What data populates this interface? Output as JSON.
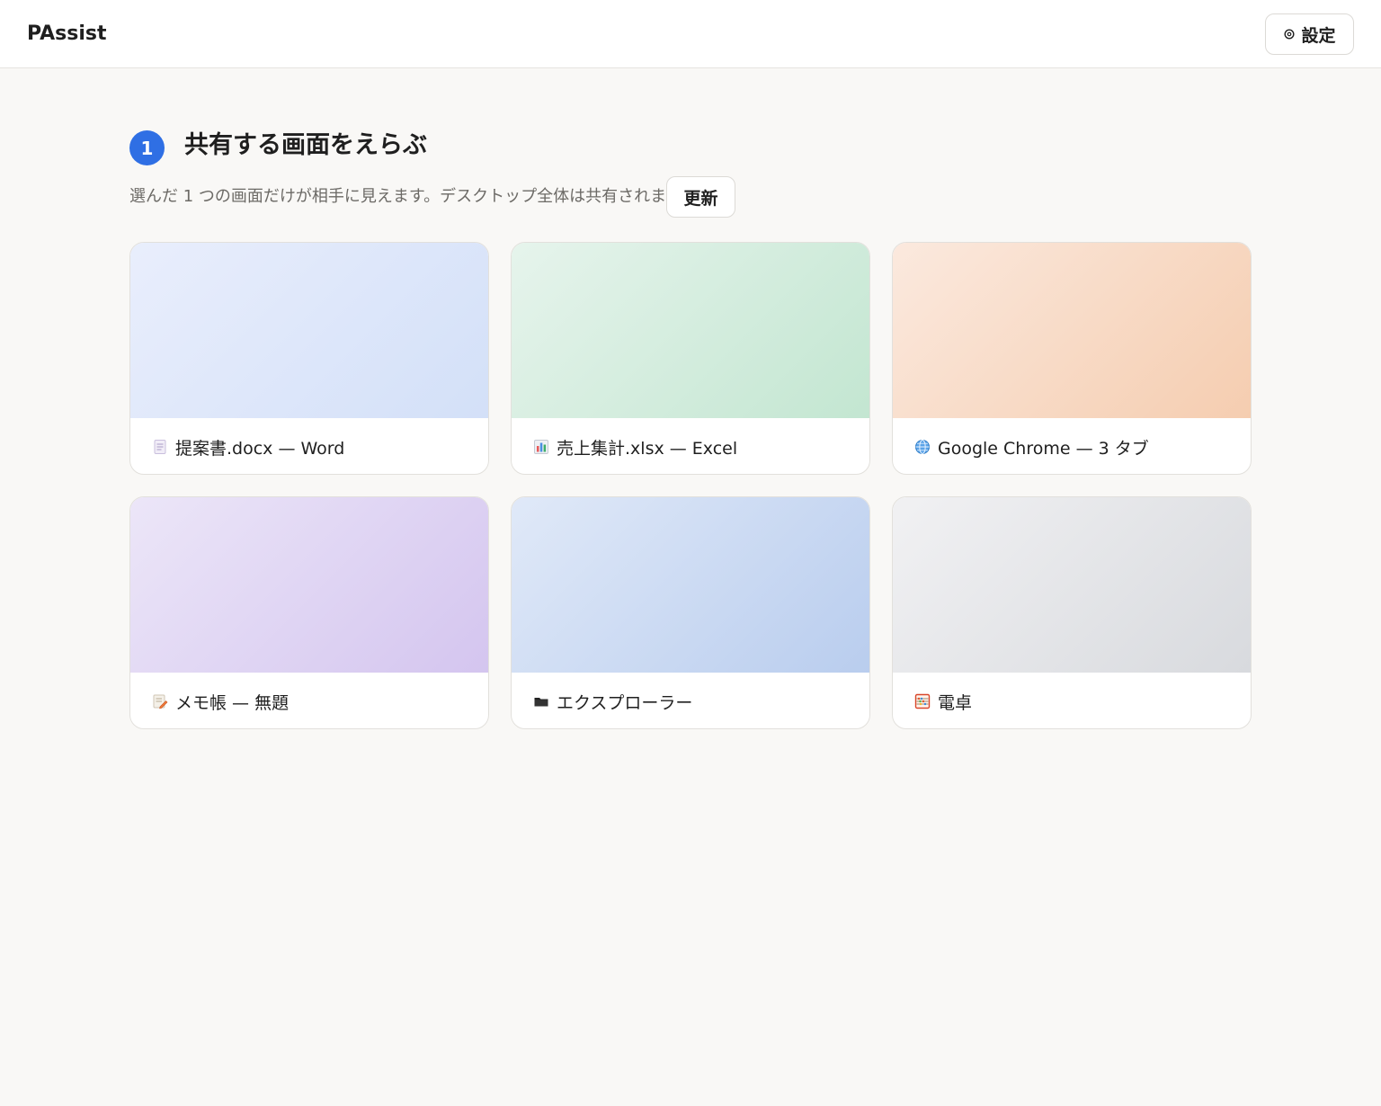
{
  "header": {
    "app_title": "PAssist",
    "settings_label": "設定"
  },
  "step": {
    "number": "1",
    "title": "共有する画面をえらぶ",
    "subtitle": "選んだ 1 つの画面だけが相手に見えます。デスクトップ全体は共有されません。",
    "refresh_label": "更新"
  },
  "windows": [
    {
      "label": "提案書.docx — Word",
      "icon": "document-icon"
    },
    {
      "label": "売上集計.xlsx — Excel",
      "icon": "bar-chart-icon"
    },
    {
      "label": "Google Chrome — 3 タブ",
      "icon": "globe-icon"
    },
    {
      "label": "メモ帳 — 無題",
      "icon": "memo-icon"
    },
    {
      "label": "エクスプローラー",
      "icon": "folder-icon"
    },
    {
      "label": "電卓",
      "icon": "abacus-icon"
    }
  ]
}
